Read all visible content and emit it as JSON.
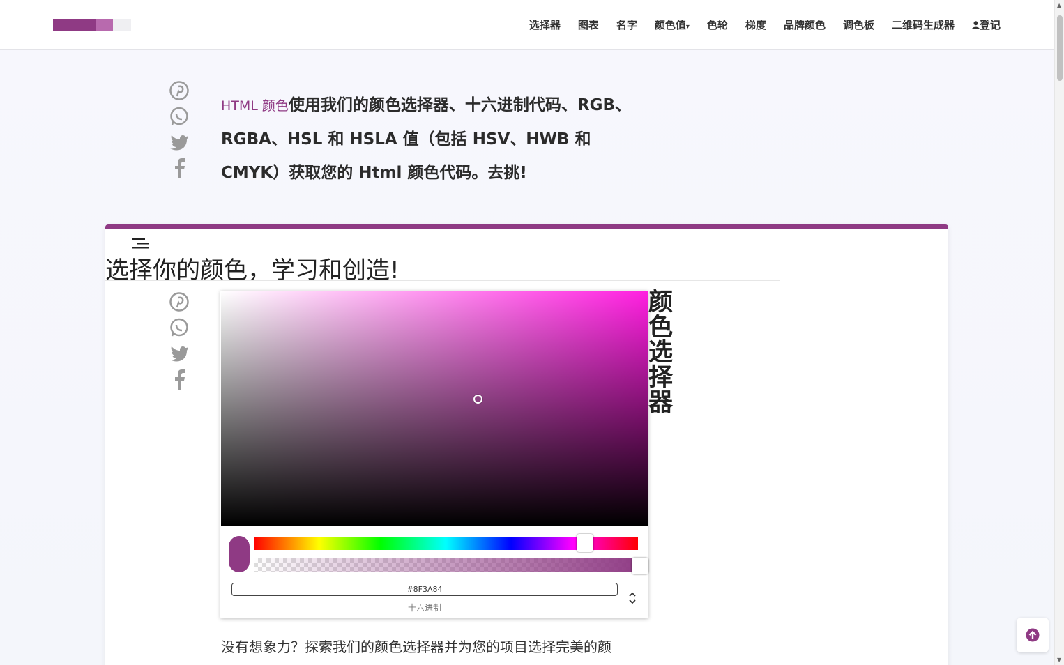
{
  "nav": {
    "items": [
      "选择器",
      "图表",
      "名字",
      "颜色值",
      "色轮",
      "梯度",
      "品牌颜色",
      "调色板",
      "二维码生成器",
      "登记"
    ],
    "dropdown_caret": "▾"
  },
  "logo": {
    "colors": [
      "#8f3a84",
      "#b86aae",
      "#f0f0f0"
    ]
  },
  "intro": {
    "accent": "HTML 颜色",
    "text": "使用我们的颜色选择器、十六进制代码、RGB、RGBA、HSL 和 HSLA 值（包括 HSV、HWB 和 CMYK）获取您的 Html 颜色代码。去挑!"
  },
  "social_icons": [
    "pinterest-icon",
    "whatsapp-icon",
    "twitter-icon",
    "facebook-icon"
  ],
  "card": {
    "title": "选择你的颜色，学习和创造!",
    "vertical_heading": [
      "颜",
      "色",
      "选",
      "择",
      "器"
    ]
  },
  "picker": {
    "hex_value": "#8F3A84",
    "format_label": "十六进制",
    "current_color": "#8f3a84",
    "hue_color": "#ff1fe0",
    "mode_toggle": "⌃⌄"
  },
  "bottom_text": "没有想象力？探索我们的颜色选择器并为您的项目选择完美的颜",
  "colors": {
    "accent": "#8f3a84"
  }
}
